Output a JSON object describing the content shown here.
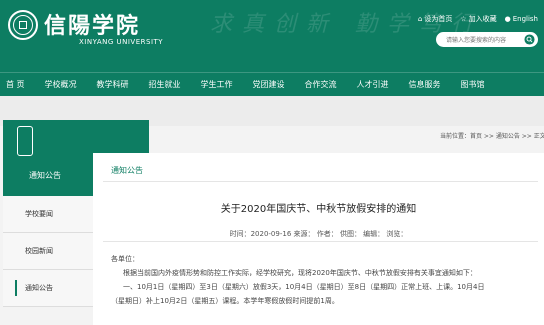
{
  "header": {
    "logo_cn": "信陽学院",
    "logo_en": "XINYANG UNIVERSITY",
    "bg_slogan": "求真创新 勤学笃行",
    "top_links": [
      "设为首页",
      "加入收藏",
      "English"
    ],
    "search_placeholder": "请输入您要搜索的内容"
  },
  "nav": {
    "items": [
      "首 页",
      "学校概况",
      "教学科研",
      "招生就业",
      "学生工作",
      "党团建设",
      "合作交流",
      "人才引进",
      "信息服务",
      "图书馆"
    ]
  },
  "sidebar": {
    "title": "通知公告",
    "items": [
      "学校要闻",
      "校园新闻",
      "通知公告"
    ],
    "active_index": 2
  },
  "breadcrumb": "当前位置：首页 >> 通知公告 >> 正文",
  "content": {
    "tab": "通知公告",
    "headline": "关于2020年国庆节、中秋节放假安排的通知",
    "meta": "时间：2020-09-16   来源：   作者：   供图：   编辑：   浏览：",
    "greeting": "各单位：",
    "para1": "根据当前国内外疫情形势和防控工作实际，经学校研究，现将2020年国庆节、中秋节放假安排有关事宜通知如下：",
    "para2": "一、10月1日（星期四）至3日（星期六）放假3天，10月4日（星期日）至8日（星期四）正常上班、上课。10月4日",
    "para3": "（星期日）补上10月2日（星期五）课程。本学年寒假放假时间提前1周。"
  },
  "colors": {
    "brand_green": "#0d7d62"
  }
}
